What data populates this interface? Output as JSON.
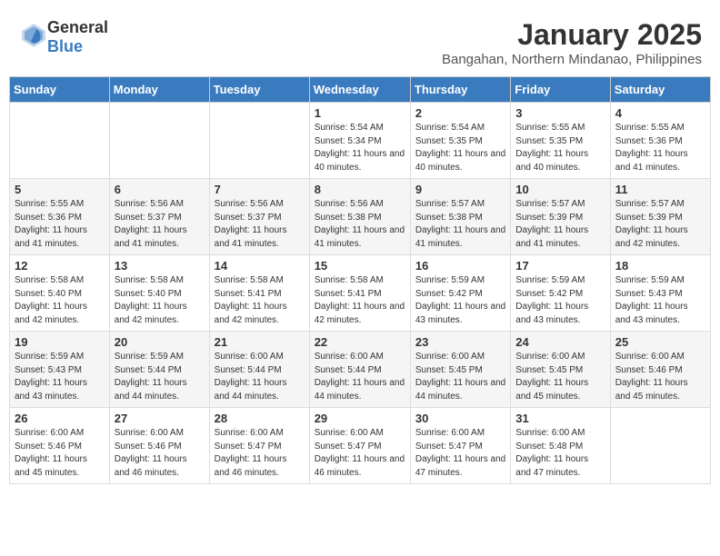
{
  "logo": {
    "general": "General",
    "blue": "Blue"
  },
  "header": {
    "month": "January 2025",
    "location": "Bangahan, Northern Mindanao, Philippines"
  },
  "weekdays": [
    "Sunday",
    "Monday",
    "Tuesday",
    "Wednesday",
    "Thursday",
    "Friday",
    "Saturday"
  ],
  "weeks": [
    [
      null,
      null,
      null,
      {
        "day": "1",
        "sunrise": "Sunrise: 5:54 AM",
        "sunset": "Sunset: 5:34 PM",
        "daylight": "Daylight: 11 hours and 40 minutes."
      },
      {
        "day": "2",
        "sunrise": "Sunrise: 5:54 AM",
        "sunset": "Sunset: 5:35 PM",
        "daylight": "Daylight: 11 hours and 40 minutes."
      },
      {
        "day": "3",
        "sunrise": "Sunrise: 5:55 AM",
        "sunset": "Sunset: 5:35 PM",
        "daylight": "Daylight: 11 hours and 40 minutes."
      },
      {
        "day": "4",
        "sunrise": "Sunrise: 5:55 AM",
        "sunset": "Sunset: 5:36 PM",
        "daylight": "Daylight: 11 hours and 41 minutes."
      }
    ],
    [
      {
        "day": "5",
        "sunrise": "Sunrise: 5:55 AM",
        "sunset": "Sunset: 5:36 PM",
        "daylight": "Daylight: 11 hours and 41 minutes."
      },
      {
        "day": "6",
        "sunrise": "Sunrise: 5:56 AM",
        "sunset": "Sunset: 5:37 PM",
        "daylight": "Daylight: 11 hours and 41 minutes."
      },
      {
        "day": "7",
        "sunrise": "Sunrise: 5:56 AM",
        "sunset": "Sunset: 5:37 PM",
        "daylight": "Daylight: 11 hours and 41 minutes."
      },
      {
        "day": "8",
        "sunrise": "Sunrise: 5:56 AM",
        "sunset": "Sunset: 5:38 PM",
        "daylight": "Daylight: 11 hours and 41 minutes."
      },
      {
        "day": "9",
        "sunrise": "Sunrise: 5:57 AM",
        "sunset": "Sunset: 5:38 PM",
        "daylight": "Daylight: 11 hours and 41 minutes."
      },
      {
        "day": "10",
        "sunrise": "Sunrise: 5:57 AM",
        "sunset": "Sunset: 5:39 PM",
        "daylight": "Daylight: 11 hours and 41 minutes."
      },
      {
        "day": "11",
        "sunrise": "Sunrise: 5:57 AM",
        "sunset": "Sunset: 5:39 PM",
        "daylight": "Daylight: 11 hours and 42 minutes."
      }
    ],
    [
      {
        "day": "12",
        "sunrise": "Sunrise: 5:58 AM",
        "sunset": "Sunset: 5:40 PM",
        "daylight": "Daylight: 11 hours and 42 minutes."
      },
      {
        "day": "13",
        "sunrise": "Sunrise: 5:58 AM",
        "sunset": "Sunset: 5:40 PM",
        "daylight": "Daylight: 11 hours and 42 minutes."
      },
      {
        "day": "14",
        "sunrise": "Sunrise: 5:58 AM",
        "sunset": "Sunset: 5:41 PM",
        "daylight": "Daylight: 11 hours and 42 minutes."
      },
      {
        "day": "15",
        "sunrise": "Sunrise: 5:58 AM",
        "sunset": "Sunset: 5:41 PM",
        "daylight": "Daylight: 11 hours and 42 minutes."
      },
      {
        "day": "16",
        "sunrise": "Sunrise: 5:59 AM",
        "sunset": "Sunset: 5:42 PM",
        "daylight": "Daylight: 11 hours and 43 minutes."
      },
      {
        "day": "17",
        "sunrise": "Sunrise: 5:59 AM",
        "sunset": "Sunset: 5:42 PM",
        "daylight": "Daylight: 11 hours and 43 minutes."
      },
      {
        "day": "18",
        "sunrise": "Sunrise: 5:59 AM",
        "sunset": "Sunset: 5:43 PM",
        "daylight": "Daylight: 11 hours and 43 minutes."
      }
    ],
    [
      {
        "day": "19",
        "sunrise": "Sunrise: 5:59 AM",
        "sunset": "Sunset: 5:43 PM",
        "daylight": "Daylight: 11 hours and 43 minutes."
      },
      {
        "day": "20",
        "sunrise": "Sunrise: 5:59 AM",
        "sunset": "Sunset: 5:44 PM",
        "daylight": "Daylight: 11 hours and 44 minutes."
      },
      {
        "day": "21",
        "sunrise": "Sunrise: 6:00 AM",
        "sunset": "Sunset: 5:44 PM",
        "daylight": "Daylight: 11 hours and 44 minutes."
      },
      {
        "day": "22",
        "sunrise": "Sunrise: 6:00 AM",
        "sunset": "Sunset: 5:44 PM",
        "daylight": "Daylight: 11 hours and 44 minutes."
      },
      {
        "day": "23",
        "sunrise": "Sunrise: 6:00 AM",
        "sunset": "Sunset: 5:45 PM",
        "daylight": "Daylight: 11 hours and 44 minutes."
      },
      {
        "day": "24",
        "sunrise": "Sunrise: 6:00 AM",
        "sunset": "Sunset: 5:45 PM",
        "daylight": "Daylight: 11 hours and 45 minutes."
      },
      {
        "day": "25",
        "sunrise": "Sunrise: 6:00 AM",
        "sunset": "Sunset: 5:46 PM",
        "daylight": "Daylight: 11 hours and 45 minutes."
      }
    ],
    [
      {
        "day": "26",
        "sunrise": "Sunrise: 6:00 AM",
        "sunset": "Sunset: 5:46 PM",
        "daylight": "Daylight: 11 hours and 45 minutes."
      },
      {
        "day": "27",
        "sunrise": "Sunrise: 6:00 AM",
        "sunset": "Sunset: 5:46 PM",
        "daylight": "Daylight: 11 hours and 46 minutes."
      },
      {
        "day": "28",
        "sunrise": "Sunrise: 6:00 AM",
        "sunset": "Sunset: 5:47 PM",
        "daylight": "Daylight: 11 hours and 46 minutes."
      },
      {
        "day": "29",
        "sunrise": "Sunrise: 6:00 AM",
        "sunset": "Sunset: 5:47 PM",
        "daylight": "Daylight: 11 hours and 46 minutes."
      },
      {
        "day": "30",
        "sunrise": "Sunrise: 6:00 AM",
        "sunset": "Sunset: 5:47 PM",
        "daylight": "Daylight: 11 hours and 47 minutes."
      },
      {
        "day": "31",
        "sunrise": "Sunrise: 6:00 AM",
        "sunset": "Sunset: 5:48 PM",
        "daylight": "Daylight: 11 hours and 47 minutes."
      },
      null
    ]
  ]
}
